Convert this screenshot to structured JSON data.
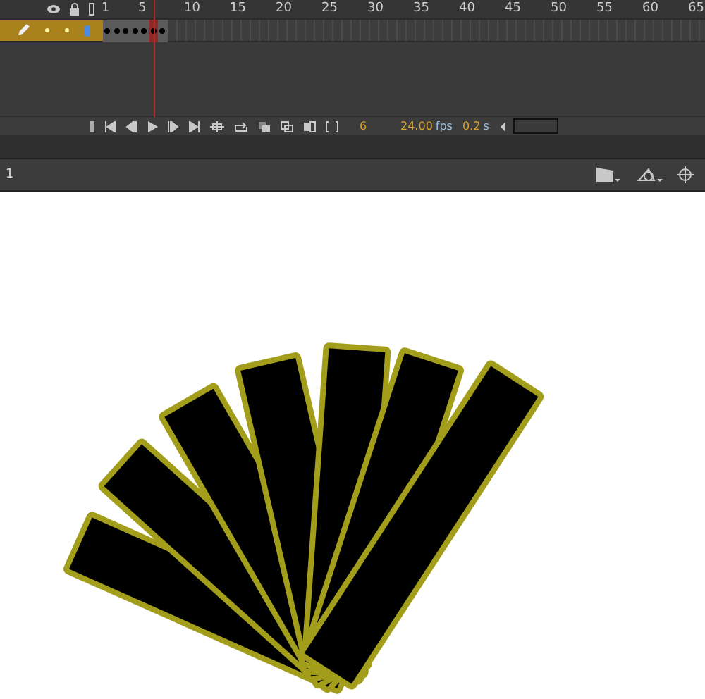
{
  "timeline": {
    "ruler": [
      "1",
      "5",
      "10",
      "15",
      "20",
      "25",
      "30",
      "35",
      "40",
      "45",
      "50",
      "55",
      "60",
      "65"
    ],
    "layers": [
      {
        "selected": true,
        "frames": [
          {
            "keyframe": true,
            "selected": false
          },
          {
            "keyframe": true,
            "selected": false
          },
          {
            "keyframe": true,
            "selected": false
          },
          {
            "keyframe": true,
            "selected": false
          },
          {
            "keyframe": true,
            "selected": false
          },
          {
            "keyframe": true,
            "selected": true
          },
          {
            "keyframe": true,
            "selected": false
          }
        ]
      }
    ],
    "controls": {
      "current_frame": "6",
      "frame_rate": "24.00",
      "frame_rate_unit": "fps",
      "elapsed": "0.2",
      "elapsed_unit": "s"
    }
  },
  "edit_bar": {
    "scene": "1"
  }
}
